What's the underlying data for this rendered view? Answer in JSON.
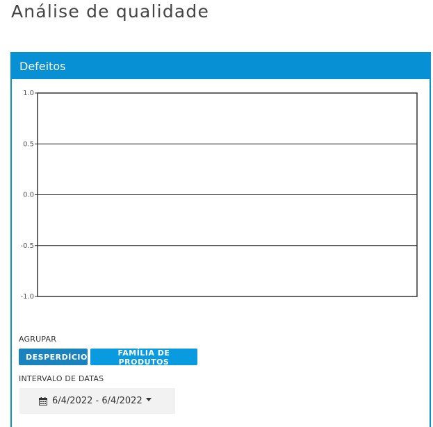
{
  "page": {
    "title": "Análise de qualidade"
  },
  "panel": {
    "title": "Defeitos"
  },
  "chart_data": {
    "type": "line",
    "title": "",
    "xlabel": "",
    "ylabel": "",
    "ylim": [
      -1.0,
      1.0
    ],
    "y_ticks": [
      "1.0",
      "0.5",
      "0.0",
      "-0.5",
      "-1.0"
    ],
    "y_tick_values": [
      1.0,
      0.5,
      0.0,
      -0.5,
      -1.0
    ],
    "series": [],
    "grid": true
  },
  "group": {
    "label": "AGRUPAR",
    "buttons": [
      "DESPERDÍCIO",
      "FAMÍLIA DE PRODUTOS"
    ]
  },
  "date_range": {
    "label": "INTERVALO DE DATAS",
    "value": "6/4/2022 - 6/4/2022",
    "icon": "calendar-icon"
  },
  "colors": {
    "accent": "#0890d5",
    "button_primary": "#1a83bd",
    "button_secondary": "#0a9ae0"
  }
}
